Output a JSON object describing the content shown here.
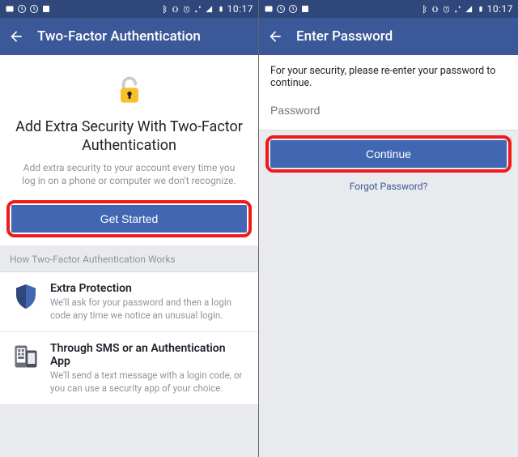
{
  "statusbar": {
    "time": "10:17"
  },
  "left": {
    "appbar_title": "Two-Factor Authentication",
    "hero_title": "Add Extra Security With Two-Factor Authentication",
    "hero_subtitle": "Add extra security to your account every time you log in on a phone or computer we don't recognize.",
    "cta_label": "Get Started",
    "section_label": "How Two-Factor Authentication Works",
    "items": [
      {
        "title": "Extra Protection",
        "desc": "We'll ask for your password and then a login code any time we notice an unusual login."
      },
      {
        "title": "Through SMS or an Authentication App",
        "desc": "We'll send a text message with a login code, or you can use a security app of your choice."
      }
    ]
  },
  "right": {
    "appbar_title": "Enter Password",
    "message": "For your security, please re-enter your password to continue.",
    "password_placeholder": "Password",
    "password_value": "",
    "cta_label": "Continue",
    "forgot_label": "Forgot Password?"
  }
}
